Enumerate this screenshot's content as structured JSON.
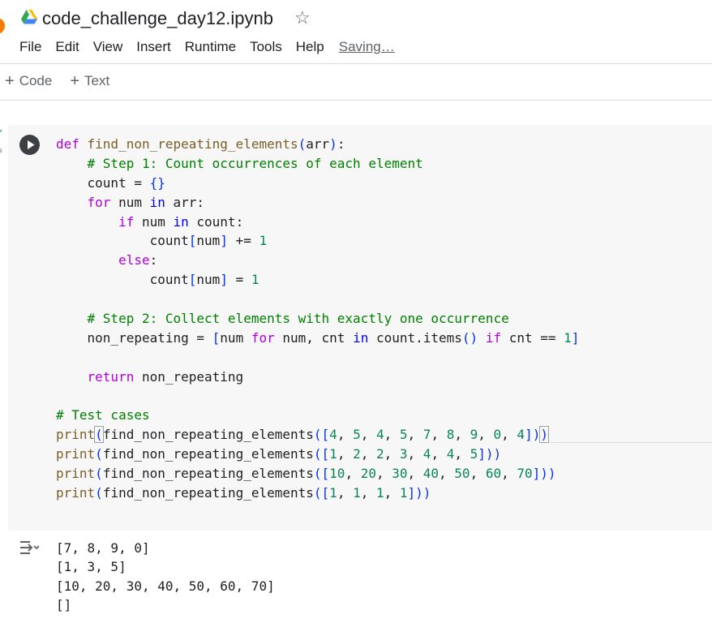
{
  "header": {
    "title": "code_challenge_day12.ipynb",
    "drive_icon": "google-drive-icon",
    "star_icon": "star-outline-icon",
    "star_glyph": "☆"
  },
  "menu": {
    "items": [
      "File",
      "Edit",
      "View",
      "Insert",
      "Runtime",
      "Tools",
      "Help"
    ],
    "status": "Saving…"
  },
  "toolbar": {
    "add_code_label": "Code",
    "add_text_label": "Text",
    "plus_glyph": "+"
  },
  "cell": {
    "run_icon": "play-circle-icon",
    "exec_check": "✓",
    "exec_time": "s",
    "code_lines": [
      [
        [
          "k",
          "def "
        ],
        [
          "fn",
          "find_non_repeating_elements"
        ],
        [
          "p",
          "("
        ],
        [
          "t",
          "arr"
        ],
        [
          "p",
          ")"
        ],
        [
          "t",
          ":"
        ]
      ],
      [
        [
          "t",
          "    "
        ],
        [
          "c",
          "# Step 1: Count occurrences of each element"
        ]
      ],
      [
        [
          "t",
          "    count = "
        ],
        [
          "p",
          "{}"
        ]
      ],
      [
        [
          "t",
          "    "
        ],
        [
          "k",
          "for"
        ],
        [
          "t",
          " num "
        ],
        [
          "kb",
          "in"
        ],
        [
          "t",
          " arr:"
        ]
      ],
      [
        [
          "t",
          "        "
        ],
        [
          "k",
          "if"
        ],
        [
          "t",
          " num "
        ],
        [
          "kb",
          "in"
        ],
        [
          "t",
          " count:"
        ]
      ],
      [
        [
          "t",
          "            count"
        ],
        [
          "p",
          "["
        ],
        [
          "t",
          "num"
        ],
        [
          "p",
          "]"
        ],
        [
          "t",
          " += "
        ],
        [
          "n",
          "1"
        ]
      ],
      [
        [
          "t",
          "        "
        ],
        [
          "k",
          "else"
        ],
        [
          "t",
          ":"
        ]
      ],
      [
        [
          "t",
          "            count"
        ],
        [
          "p",
          "["
        ],
        [
          "t",
          "num"
        ],
        [
          "p",
          "]"
        ],
        [
          "t",
          " = "
        ],
        [
          "n",
          "1"
        ]
      ],
      [],
      [
        [
          "t",
          "    "
        ],
        [
          "c",
          "# Step 2: Collect elements with exactly one occurrence"
        ]
      ],
      [
        [
          "t",
          "    non_repeating = "
        ],
        [
          "p",
          "["
        ],
        [
          "t",
          "num "
        ],
        [
          "k",
          "for"
        ],
        [
          "t",
          " num, cnt "
        ],
        [
          "kb",
          "in"
        ],
        [
          "t",
          " count.items"
        ],
        [
          "p",
          "()"
        ],
        [
          "t",
          " "
        ],
        [
          "k",
          "if"
        ],
        [
          "t",
          " cnt == "
        ],
        [
          "n",
          "1"
        ],
        [
          "p",
          "]"
        ]
      ],
      [],
      [
        [
          "t",
          "    "
        ],
        [
          "k",
          "return"
        ],
        [
          "t",
          " non_repeating"
        ]
      ],
      [],
      [
        [
          "c",
          "# Test cases"
        ]
      ],
      [
        [
          "fn",
          "print"
        ],
        [
          "pc",
          "("
        ],
        [
          "t",
          "find_non_repeating_elements"
        ],
        [
          "p",
          "(["
        ],
        [
          "n",
          "4"
        ],
        [
          "t",
          ", "
        ],
        [
          "n",
          "5"
        ],
        [
          "t",
          ", "
        ],
        [
          "n",
          "4"
        ],
        [
          "t",
          ", "
        ],
        [
          "n",
          "5"
        ],
        [
          "t",
          ", "
        ],
        [
          "n",
          "7"
        ],
        [
          "t",
          ", "
        ],
        [
          "n",
          "8"
        ],
        [
          "t",
          ", "
        ],
        [
          "n",
          "9"
        ],
        [
          "t",
          ", "
        ],
        [
          "n",
          "0"
        ],
        [
          "t",
          ", "
        ],
        [
          "n",
          "4"
        ],
        [
          "p",
          "])"
        ],
        [
          "pc",
          ")"
        ]
      ],
      [
        [
          "fn",
          "print"
        ],
        [
          "p",
          "("
        ],
        [
          "t",
          "find_non_repeating_elements"
        ],
        [
          "p",
          "(["
        ],
        [
          "n",
          "1"
        ],
        [
          "t",
          ", "
        ],
        [
          "n",
          "2"
        ],
        [
          "t",
          ", "
        ],
        [
          "n",
          "2"
        ],
        [
          "t",
          ", "
        ],
        [
          "n",
          "3"
        ],
        [
          "t",
          ", "
        ],
        [
          "n",
          "4"
        ],
        [
          "t",
          ", "
        ],
        [
          "n",
          "4"
        ],
        [
          "t",
          ", "
        ],
        [
          "n",
          "5"
        ],
        [
          "p",
          "]))"
        ]
      ],
      [
        [
          "fn",
          "print"
        ],
        [
          "p",
          "("
        ],
        [
          "t",
          "find_non_repeating_elements"
        ],
        [
          "p",
          "(["
        ],
        [
          "n",
          "10"
        ],
        [
          "t",
          ", "
        ],
        [
          "n",
          "20"
        ],
        [
          "t",
          ", "
        ],
        [
          "n",
          "30"
        ],
        [
          "t",
          ", "
        ],
        [
          "n",
          "40"
        ],
        [
          "t",
          ", "
        ],
        [
          "n",
          "50"
        ],
        [
          "t",
          ", "
        ],
        [
          "n",
          "60"
        ],
        [
          "t",
          ", "
        ],
        [
          "n",
          "70"
        ],
        [
          "p",
          "]))"
        ]
      ],
      [
        [
          "fn",
          "print"
        ],
        [
          "p",
          "("
        ],
        [
          "t",
          "find_non_repeating_elements"
        ],
        [
          "p",
          "(["
        ],
        [
          "n",
          "1"
        ],
        [
          "t",
          ", "
        ],
        [
          "n",
          "1"
        ],
        [
          "t",
          ", "
        ],
        [
          "n",
          "1"
        ],
        [
          "t",
          ", "
        ],
        [
          "n",
          "1"
        ],
        [
          "p",
          "]))"
        ]
      ]
    ]
  },
  "output": {
    "icon": "output-actions-icon",
    "lines": [
      "[7, 8, 9, 0]",
      "[1, 3, 5]",
      "[10, 20, 30, 40, 50, 60, 70]",
      "[]"
    ]
  },
  "colors": {
    "keyword": "#af00db",
    "keyword_builtin": "#0000ff",
    "function": "#795e26",
    "comment": "#008000",
    "number": "#098658",
    "punctuation": "#0431fa",
    "cell_background": "#f7f7f7"
  }
}
